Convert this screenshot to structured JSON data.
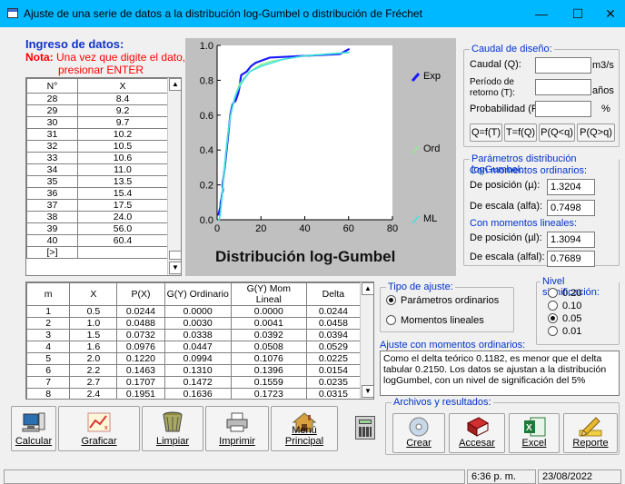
{
  "window": {
    "title": "Ajuste de una serie de datos a la distribución log-Gumbel o distribución de Fréchet"
  },
  "ingreso": {
    "heading": "Ingreso de datos:",
    "note_label": "Nota:",
    "note_text": " Una vez que digite el dato,",
    "note_text2": "presionar ENTER",
    "col_n": "N°",
    "col_x": "X",
    "rows": [
      {
        "n": "28",
        "x": "8.4"
      },
      {
        "n": "29",
        "x": "9.2"
      },
      {
        "n": "30",
        "x": "9.7"
      },
      {
        "n": "31",
        "x": "10.2"
      },
      {
        "n": "32",
        "x": "10.5"
      },
      {
        "n": "33",
        "x": "10.6"
      },
      {
        "n": "34",
        "x": "11.0"
      },
      {
        "n": "35",
        "x": "13.5"
      },
      {
        "n": "36",
        "x": "15.4"
      },
      {
        "n": "37",
        "x": "17.5"
      },
      {
        "n": "38",
        "x": "24.0"
      },
      {
        "n": "39",
        "x": "56.0"
      },
      {
        "n": "40",
        "x": "60.4"
      },
      {
        "n": "[>]",
        "x": ""
      }
    ]
  },
  "chart": {
    "xlabel": "Distribución log-Gumbel",
    "legend_exp": "Exp",
    "legend_ord": "Ord",
    "legend_ml": "ML",
    "yticks": [
      "0.0",
      "0.2",
      "0.4",
      "0.6",
      "0.8",
      "1.0"
    ],
    "xticks": [
      "0",
      "20",
      "40",
      "60",
      "80"
    ],
    "colors": {
      "exp": "#1a1aff",
      "ord": "#90ee90",
      "ml": "#40e0e0",
      "bg": "#c0c0c0"
    }
  },
  "chart_data": {
    "type": "line",
    "xlabel": "Distribución log-Gumbel",
    "ylabel": "",
    "xlim": [
      0,
      80
    ],
    "ylim": [
      0,
      1
    ],
    "series": [
      {
        "name": "Exp",
        "x": [
          0.5,
          1.0,
          1.5,
          1.6,
          2.0,
          2.2,
          2.7,
          2.4,
          3.0,
          3.5,
          4.0,
          4.5,
          5.0,
          5.5,
          6.0,
          7.0,
          8.0,
          8.4,
          9.2,
          9.7,
          10.2,
          10.5,
          10.6,
          11.0,
          13.5,
          15.4,
          17.5,
          24.0,
          56.0,
          60.4
        ],
        "y": [
          0.0244,
          0.0488,
          0.0732,
          0.0976,
          0.122,
          0.1463,
          0.1707,
          0.1951,
          0.25,
          0.3,
          0.36,
          0.42,
          0.48,
          0.54,
          0.6,
          0.66,
          0.68,
          0.68,
          0.71,
          0.73,
          0.76,
          0.78,
          0.8,
          0.83,
          0.85,
          0.88,
          0.9,
          0.93,
          0.95,
          0.98
        ]
      },
      {
        "name": "Ord",
        "x": [
          0.5,
          1.0,
          1.5,
          2.0,
          3.0,
          4.0,
          5.0,
          6.0,
          8.0,
          10.0,
          12.0,
          15.0,
          20.0,
          25.0,
          30.0,
          40.0,
          50.0,
          60.4
        ],
        "y": [
          0.0,
          0.003,
          0.034,
          0.099,
          0.24,
          0.38,
          0.5,
          0.59,
          0.7,
          0.77,
          0.81,
          0.85,
          0.89,
          0.91,
          0.92,
          0.94,
          0.95,
          0.96
        ]
      },
      {
        "name": "ML",
        "x": [
          0.5,
          1.0,
          1.5,
          2.0,
          3.0,
          4.0,
          5.0,
          6.0,
          8.0,
          10.0,
          12.0,
          15.0,
          20.0,
          25.0,
          30.0,
          40.0,
          50.0,
          60.4
        ],
        "y": [
          0.0,
          0.004,
          0.039,
          0.108,
          0.25,
          0.39,
          0.5,
          0.59,
          0.7,
          0.76,
          0.8,
          0.85,
          0.88,
          0.9,
          0.92,
          0.94,
          0.95,
          0.96
        ]
      }
    ]
  },
  "caudal": {
    "legend": "Caudal de diseño:",
    "q_label": "Caudal (Q):",
    "q_value": "",
    "q_unit": "m3/s",
    "t_label1": "Período de",
    "t_label2": "retorno (T):",
    "t_value": "",
    "t_unit": "años",
    "p_label": "Probabilidad (P):",
    "p_value": "",
    "p_unit": "%",
    "btn_qt": "Q=f(T)",
    "btn_tq": "T=f(Q)",
    "btn_pqlq": "P(Q<q)",
    "btn_pqgq": "P(Q>q)"
  },
  "parametros": {
    "legend": "Parámetros distribución logGumbel:",
    "ord_heading": "Con momentos ordinarios:",
    "pos_label": "De posición (µ):",
    "pos_value": "1.3204",
    "esc_label": "De escala (alfa):",
    "esc_value": "0.7498",
    "lin_heading": "Con momentos lineales:",
    "pos_l_label": "De posición (µl):",
    "pos_l_value": "1.3094",
    "esc_l_label": "De escala (alfal):",
    "esc_l_value": "0.7689"
  },
  "resultados_table": {
    "headers": [
      "m",
      "X",
      "P(X)",
      "G(Y) Ordinario",
      "G(Y) Mom Lineal",
      "Delta"
    ],
    "rows": [
      [
        "1",
        "0.5",
        "0.0244",
        "0.0000",
        "0.0000",
        "0.0244"
      ],
      [
        "2",
        "1.0",
        "0.0488",
        "0.0030",
        "0.0041",
        "0.0458"
      ],
      [
        "3",
        "1.5",
        "0.0732",
        "0.0338",
        "0.0392",
        "0.0394"
      ],
      [
        "4",
        "1.6",
        "0.0976",
        "0.0447",
        "0.0508",
        "0.0529"
      ],
      [
        "5",
        "2.0",
        "0.1220",
        "0.0994",
        "0.1076",
        "0.0225"
      ],
      [
        "6",
        "2.2",
        "0.1463",
        "0.1310",
        "0.1396",
        "0.0154"
      ],
      [
        "7",
        "2.7",
        "0.1707",
        "0.1472",
        "0.1559",
        "0.0235"
      ],
      [
        "8",
        "2.4",
        "0.1951",
        "0.1636",
        "0.1723",
        "0.0315"
      ]
    ]
  },
  "tipo_ajuste": {
    "legend": "Tipo de ajuste:",
    "opt_ord": "Parámetros ordinarios",
    "opt_lin": "Momentos lineales"
  },
  "nivel": {
    "legend": "Nivel significación:",
    "options": [
      "0.20",
      "0.10",
      "0.05",
      "0.01"
    ],
    "selected_index": 2
  },
  "ajuste": {
    "heading": "Ajuste con momentos ordinarios:",
    "text": "Como el delta teórico 0.1182, es menor que el delta tabular 0.2150. Los datos se ajustan a la distribución logGumbel, con un nivel de significación del 5%"
  },
  "archivos": {
    "legend": "Archivos y resultados:"
  },
  "buttons": {
    "calcular": "Calcular",
    "graficar": "Graficar",
    "limpiar": "Limpiar",
    "imprimir": "Imprimir",
    "menu": "Menú Principal",
    "crear": "Crear",
    "accesar": "Accesar",
    "excel": "Excel",
    "reporte": "Reporte"
  },
  "status": {
    "time": "6:36 p. m.",
    "date": "23/08/2022"
  }
}
